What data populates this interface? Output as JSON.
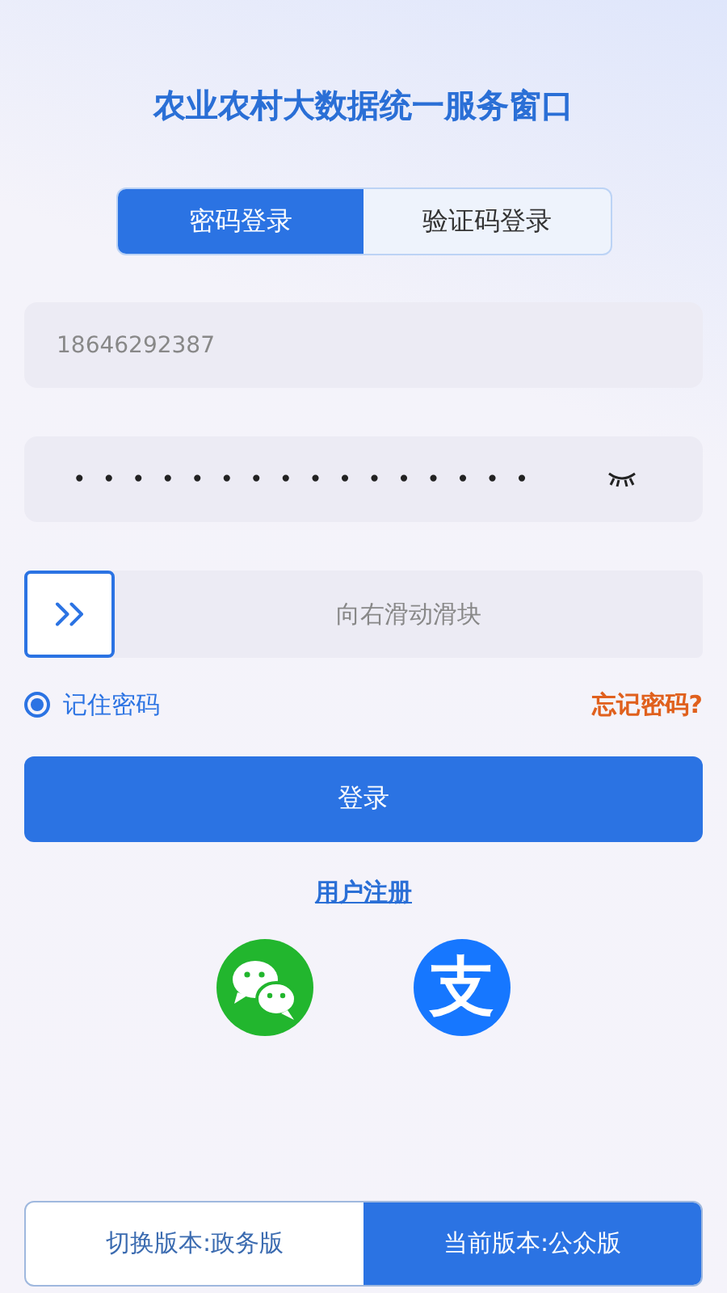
{
  "title": "农业农村大数据统一服务窗口",
  "tabs": [
    {
      "label": "密码登录",
      "selected": true
    },
    {
      "label": "验证码登录",
      "selected": false
    }
  ],
  "phone_field": {
    "value": "18646292387"
  },
  "password_field": {
    "value": "••••••••••••••••"
  },
  "slider": {
    "label": "向右滑动滑块",
    "level": 0
  },
  "remember": {
    "label": "记住密码",
    "checked": true
  },
  "forgot_link": "忘记密码?",
  "login_button": "登录",
  "register_link": "用户注册",
  "social_logins": [
    {
      "kind": "wechat"
    },
    {
      "kind": "alipay",
      "glyph": "支"
    }
  ],
  "version_switch": [
    {
      "label": "切换版本:政务版",
      "selected": false
    },
    {
      "label": "当前版本:公众版",
      "selected": true
    }
  ]
}
